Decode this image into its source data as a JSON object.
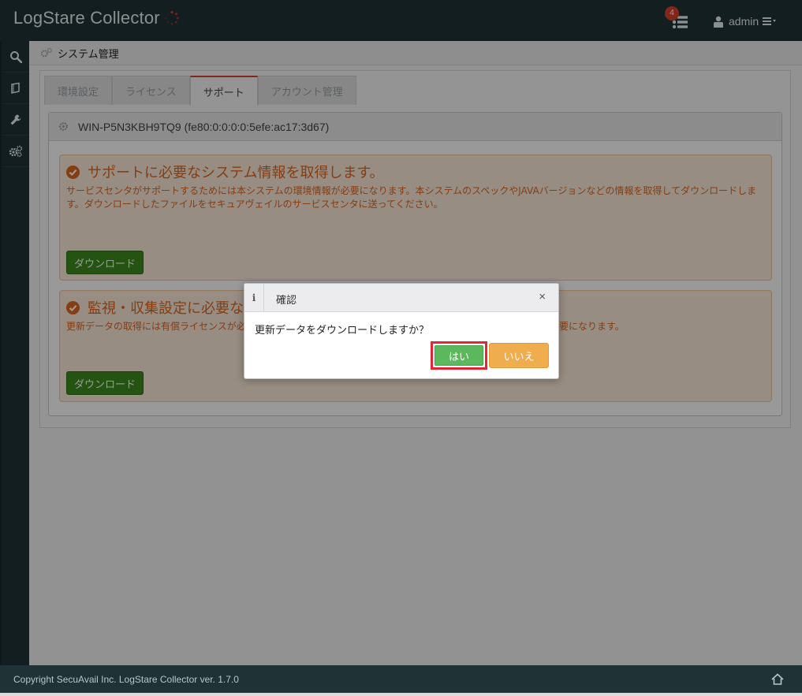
{
  "header": {
    "title": "LogStare Collector",
    "notification_count": "4",
    "user": "admin"
  },
  "breadcrumb": {
    "label": "システム管理"
  },
  "tabs": [
    {
      "label": "環境設定",
      "active": false
    },
    {
      "label": "ライセンス",
      "active": false
    },
    {
      "label": "サポート",
      "active": true
    },
    {
      "label": "アカウント管理",
      "active": false
    }
  ],
  "host": {
    "name": "WIN-P5N3KBH9TQ9 (fe80:0:0:0:0:5efe:ac17:3d67)"
  },
  "alerts": [
    {
      "title": "サポートに必要なシステム情報を取得します。",
      "description": "サービスセンタがサポートするためには本システムの環境情報が必要になります。本システムのスペックやJAVAバージョンなどの情報を取得してダウンロードします。ダウンロードしたファイルをセキュアヴェイルのサービスセンタに送ってください。",
      "button": "ダウンロード"
    },
    {
      "title": "監視・収集設定に必要な",
      "description_left": "更新データの取得には有償ライセンスが必",
      "description_right": "要になります。",
      "button": "ダウンロード"
    }
  ],
  "modal": {
    "title": "確認",
    "close": "×",
    "message": "更新データをダウンロードしますか？",
    "yes": "はい",
    "no": "いいえ"
  },
  "footer": {
    "copyright": "Copyright SecuAvail Inc. LogStare Collector ver. 1.7.0"
  },
  "colors": {
    "header_bg": "#1f3236",
    "accent_red": "#d9402c",
    "alert_text": "#e0661e",
    "download_green": "#3d8b1f",
    "yes_green": "#5cb85c",
    "no_orange": "#f0ad4e",
    "highlight": "#e32636"
  }
}
